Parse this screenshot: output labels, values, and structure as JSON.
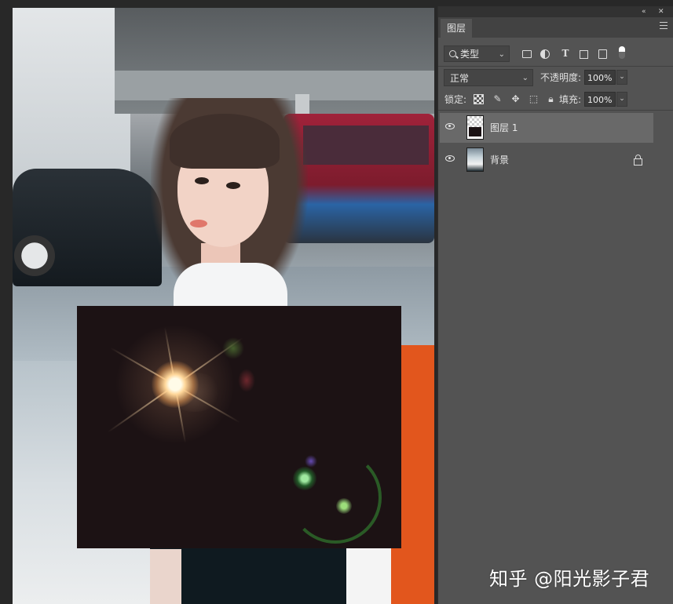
{
  "panel": {
    "collapse_glyph": "«",
    "close_glyph": "✕",
    "tab_label": "图层"
  },
  "filter": {
    "kind_label": "类型",
    "type_icon_glyph": "T"
  },
  "blend": {
    "mode": "正常",
    "opacity_label": "不透明度:",
    "opacity_value": "100%"
  },
  "lock": {
    "label": "锁定:",
    "fill_label": "填充:",
    "fill_value": "100%"
  },
  "layers": [
    {
      "name": "图层 1",
      "selected": true,
      "visible": true
    },
    {
      "name": "背景",
      "selected": false,
      "visible": true,
      "locked": true
    }
  ],
  "watermark": "知乎 @阳光影子君",
  "colors": {
    "panel_bg": "#535353",
    "selected_layer_bg": "#696969",
    "tab_bar_bg": "#424242"
  }
}
